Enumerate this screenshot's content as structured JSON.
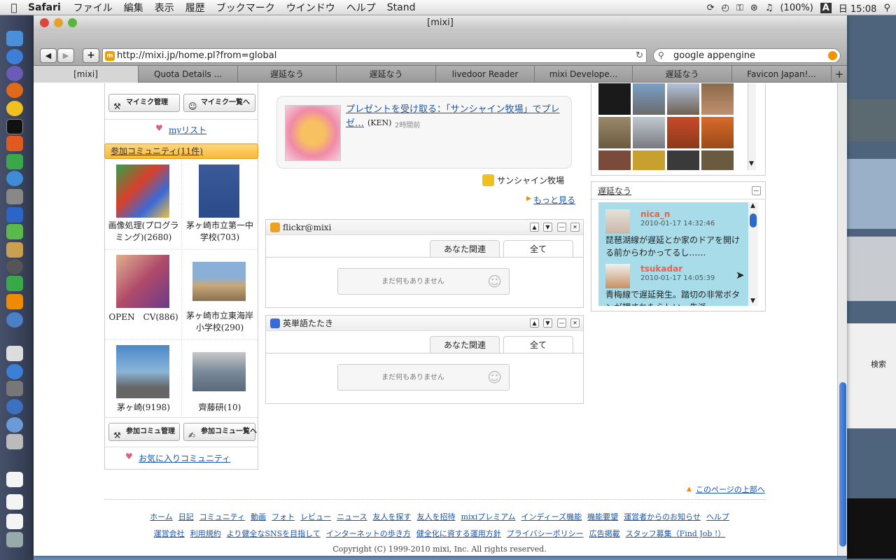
{
  "menubar": {
    "app_name": "Safari",
    "items": [
      "ファイル",
      "編集",
      "表示",
      "履歴",
      "ブックマーク",
      "ウインドウ",
      "ヘルプ",
      "Stand"
    ],
    "battery": "(100%)",
    "input_mode": "A",
    "clock": "日 15:08"
  },
  "window": {
    "title": "[mixi]",
    "url": "http://mixi.jp/home.pl?from=global",
    "search_value": "google appengine",
    "tabs": [
      "[mixi]",
      "Quota Details ...",
      "遅延なう",
      "遅延なう",
      "livedoor Reader",
      "mixi Develope...",
      "遅延なう",
      "Favicon Japan!..."
    ]
  },
  "left": {
    "mymiku_manage": "マイミク管理",
    "mymiku_list": "マイミク一覧へ",
    "mylist": "myリスト",
    "community_header": "参加コミュニティ(11件)",
    "communities": [
      {
        "name": "画像処理(プログラミング)(2680)"
      },
      {
        "name": "茅ヶ崎市立第一中学校(703)"
      },
      {
        "name": "OPEN　CV(886)"
      },
      {
        "name": "茅ヶ崎市立東海岸小学校(290)"
      },
      {
        "name": "茅ヶ崎(9198)"
      },
      {
        "name": "齊藤研(10)"
      }
    ],
    "community_manage": "参加コミュ管理",
    "community_list": "参加コミュ一覧へ",
    "fav_community": "お気に入りコミュニティ"
  },
  "middle": {
    "feed_link": "プレゼントを受け取る：「サンシャイン牧場」でプレゼ…",
    "feed_author": "(KEN)",
    "feed_time": "2時間前",
    "app_name": "サンシャイン牧場",
    "more": "もっと見る",
    "flickr_title": "flickr@mixi",
    "eng_title": "英単語たたき",
    "tab_related": "あなた関連",
    "tab_all": "全て",
    "empty": "まだ何もありません"
  },
  "right": {
    "chien_title": "遅延なう",
    "tweets": [
      {
        "user": "nica_n",
        "time": "2010-01-17 14:32:46",
        "text": "琵琶湖線が遅延とか家のドアを開ける前からわかってるし……"
      },
      {
        "user": "tsukadar",
        "time": "2010-01-17 14:05:39",
        "text": "青梅線で遅延発生。踏切の非常ボタンが押されたらしい。先派"
      }
    ]
  },
  "footer": {
    "page_top": "このページの上部へ",
    "links1": [
      "ホーム",
      "日記",
      "コミュニティ",
      "動画",
      "フォト",
      "レビュー",
      "ニュース",
      "友人を探す",
      "友人を招待",
      "mixiプレミアム",
      "インディーズ機能",
      "機能要望",
      "運営者からのお知らせ",
      "ヘルプ"
    ],
    "links2": [
      "運営会社",
      "利用規約",
      "より健全なSNSを目指して",
      "インターネットの歩き方",
      "健全化に資する運用方針",
      "プライバシーポリシー",
      "広告掲載",
      "スタッフ募集（Find Job !）"
    ],
    "copyright": "Copyright (C) 1999-2010 mixi, Inc. All rights reserved."
  },
  "desktop": {
    "right_label": "検索"
  }
}
